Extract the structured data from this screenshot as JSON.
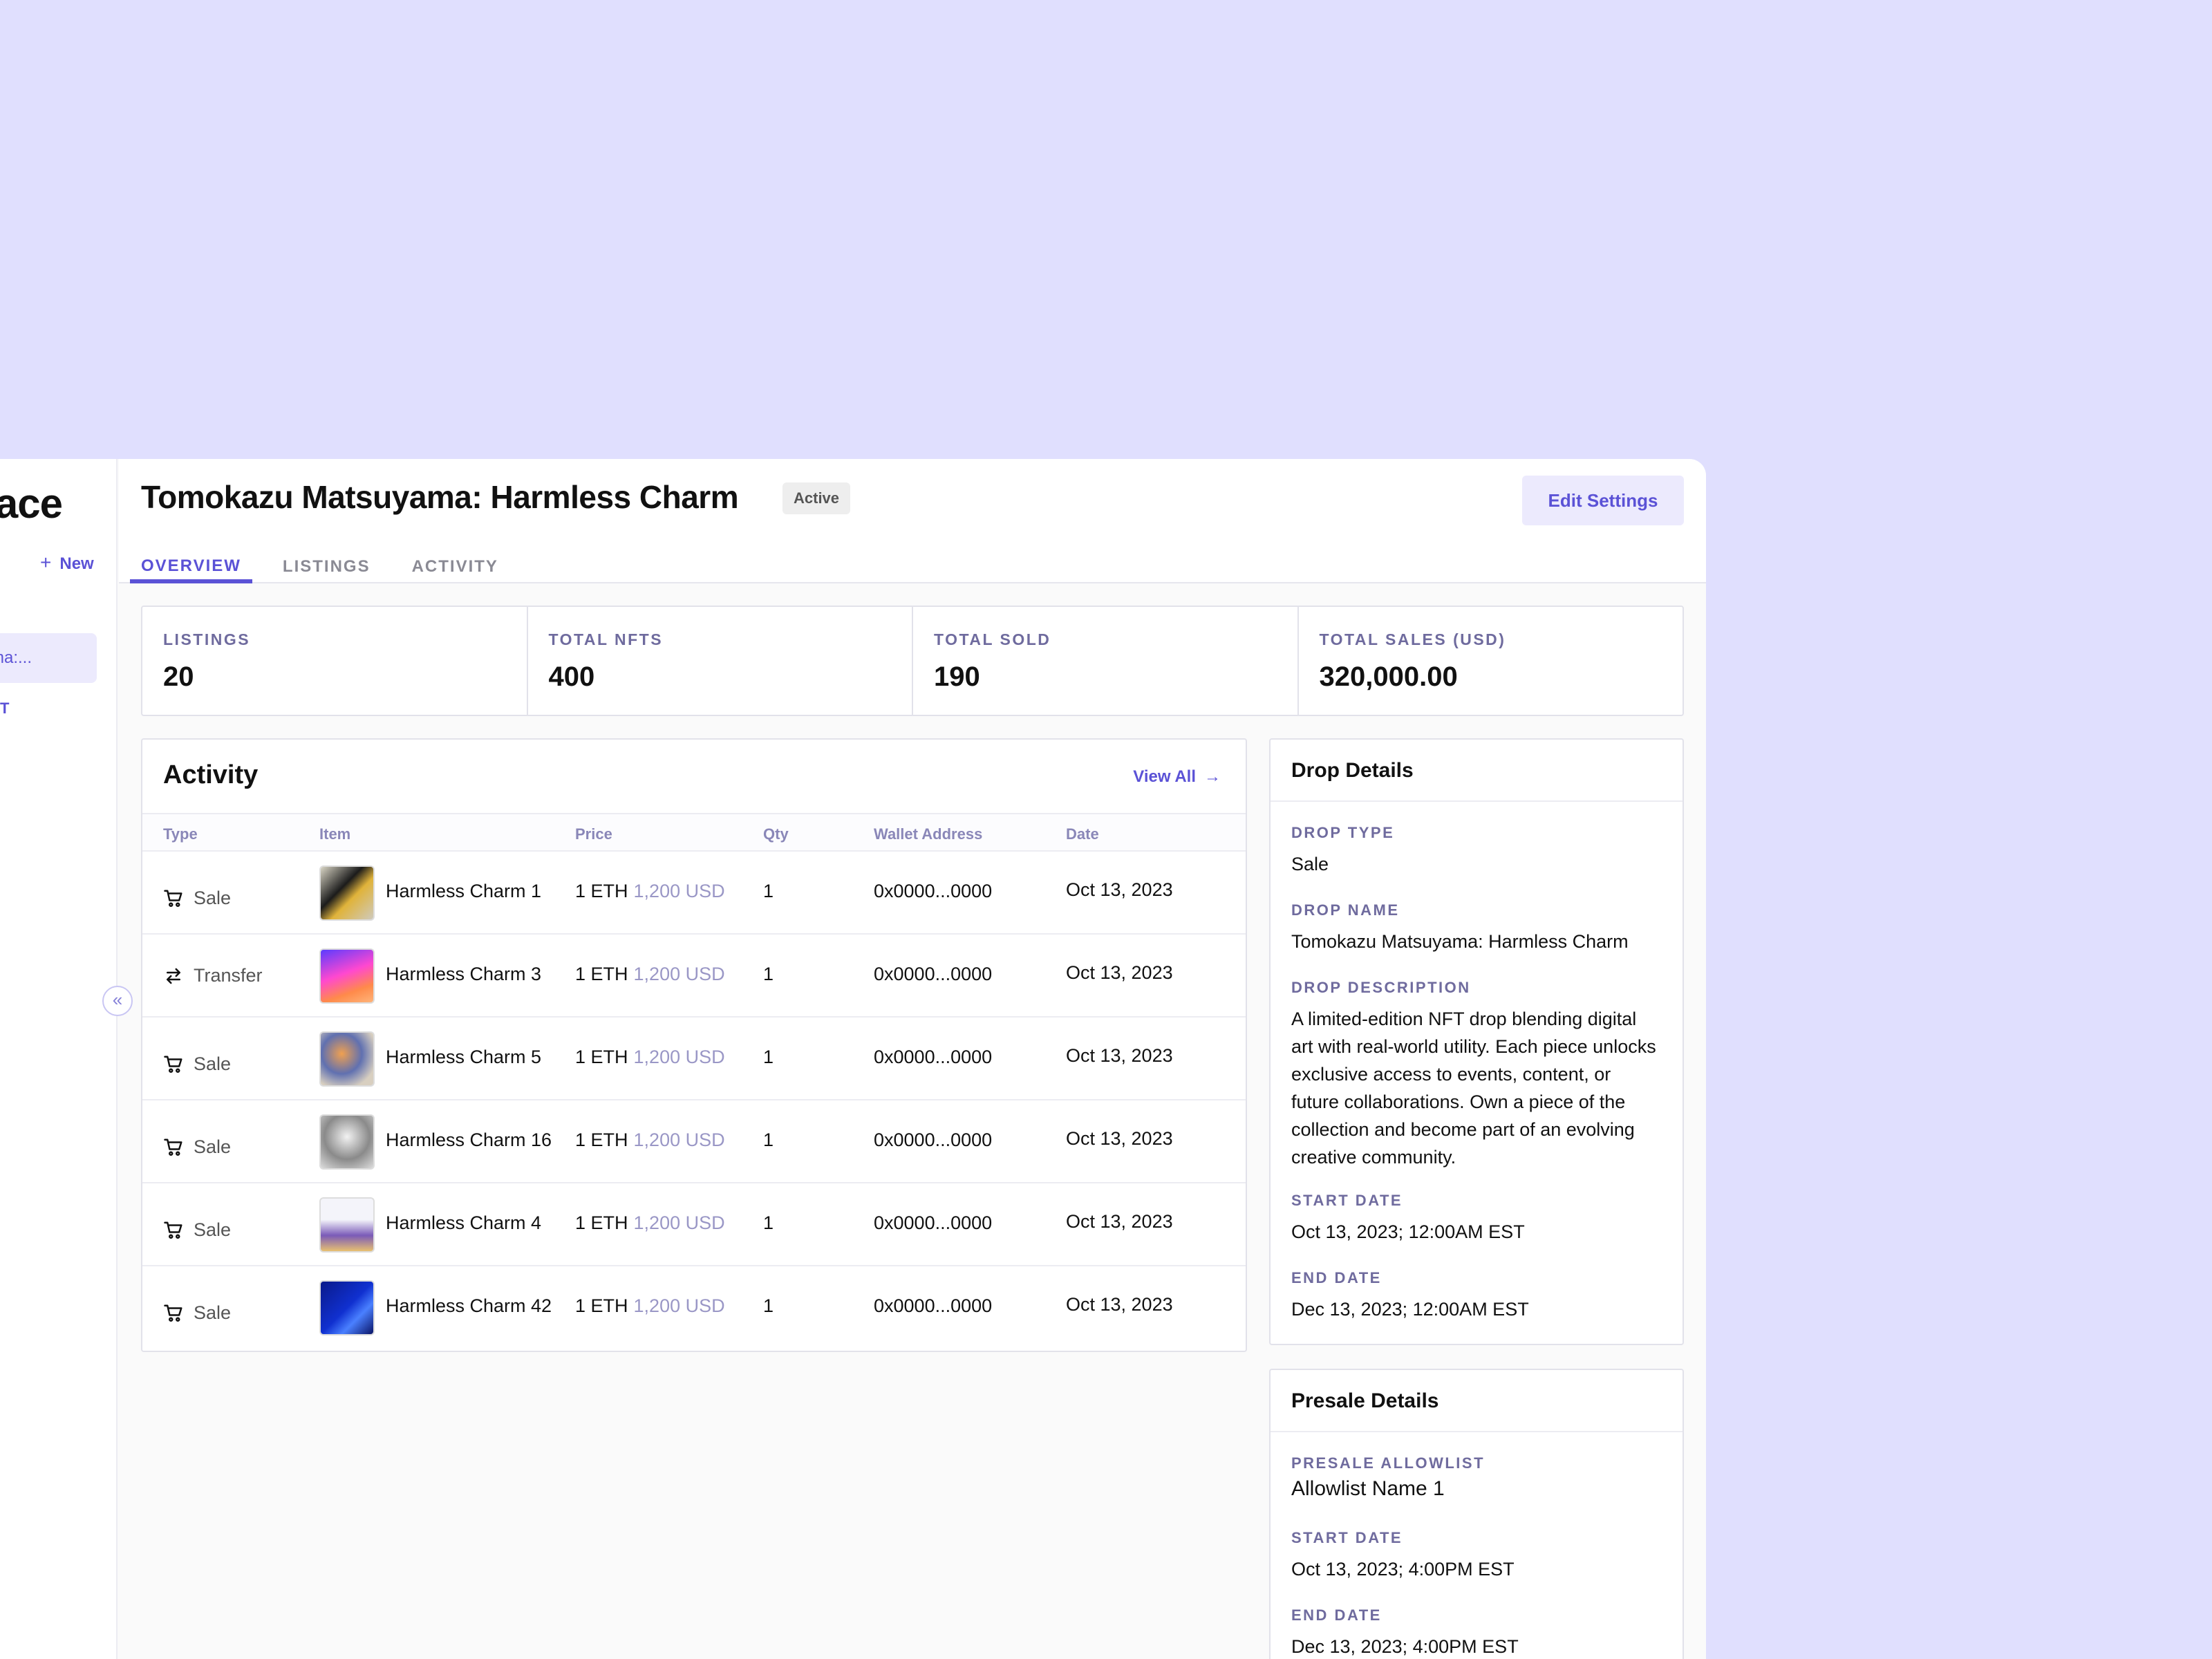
{
  "sidebar": {
    "title_fragment": "ace",
    "new_label": "New",
    "active_item": "ma:...",
    "section_fragment": "T"
  },
  "header": {
    "title": "Tomokazu Matsuyama: Harmless Charm",
    "status": "Active",
    "edit_button": "Edit Settings",
    "tabs": [
      "OVERVIEW",
      "LISTINGS",
      "ACTIVITY"
    ]
  },
  "stats": [
    {
      "label": "LISTINGS",
      "value": "20"
    },
    {
      "label": "TOTAL NFTS",
      "value": "400"
    },
    {
      "label": "TOTAL SOLD",
      "value": "190"
    },
    {
      "label": "TOTAL SALES (USD)",
      "value": "320,000.00"
    }
  ],
  "activity": {
    "title": "Activity",
    "view_all": "View All",
    "columns": [
      "Type",
      "Item",
      "Price",
      "Qty",
      "Wallet Address",
      "Date"
    ],
    "rows": [
      {
        "type": "Sale",
        "item": "Harmless Charm 1",
        "price_eth": "1 ETH",
        "price_usd": "1,200 USD",
        "qty": "1",
        "wallet": "0x0000...0000",
        "date": "Oct 13, 2023"
      },
      {
        "type": "Transfer",
        "item": "Harmless Charm 3",
        "price_eth": "1 ETH",
        "price_usd": "1,200 USD",
        "qty": "1",
        "wallet": "0x0000...0000",
        "date": "Oct 13, 2023"
      },
      {
        "type": "Sale",
        "item": "Harmless Charm 5",
        "price_eth": "1 ETH",
        "price_usd": "1,200 USD",
        "qty": "1",
        "wallet": "0x0000...0000",
        "date": "Oct 13, 2023"
      },
      {
        "type": "Sale",
        "item": "Harmless Charm 16",
        "price_eth": "1 ETH",
        "price_usd": "1,200 USD",
        "qty": "1",
        "wallet": "0x0000...0000",
        "date": "Oct 13, 2023"
      },
      {
        "type": "Sale",
        "item": "Harmless Charm 4",
        "price_eth": "1 ETH",
        "price_usd": "1,200 USD",
        "qty": "1",
        "wallet": "0x0000...0000",
        "date": "Oct 13, 2023"
      },
      {
        "type": "Sale",
        "item": "Harmless Charm 42",
        "price_eth": "1 ETH",
        "price_usd": "1,200 USD",
        "qty": "1",
        "wallet": "0x0000...0000",
        "date": "Oct 13, 2023"
      }
    ]
  },
  "drop_details": {
    "title": "Drop Details",
    "fields": [
      {
        "label": "DROP TYPE",
        "value": "Sale"
      },
      {
        "label": "DROP NAME",
        "value": "Tomokazu Matsuyama: Harmless Charm"
      },
      {
        "label": "DROP DESCRIPTION",
        "value": "A limited-edition NFT drop blending digital art with real-world utility. Each piece unlocks exclusive access to events, content, or future collaborations. Own a piece of the collection and become part of an evolving creative community."
      },
      {
        "label": "START DATE",
        "value": "Oct 13, 2023; 12:00AM EST"
      },
      {
        "label": "END DATE",
        "value": "Dec 13, 2023; 12:00AM EST"
      }
    ]
  },
  "presale_details": {
    "title": "Presale Details",
    "fields": [
      {
        "label": "PRESALE ALLOWLIST",
        "value": "Allowlist Name 1"
      },
      {
        "label": "START DATE",
        "value": "Oct 13, 2023; 4:00PM EST"
      },
      {
        "label": "END DATE",
        "value": "Dec 13, 2023; 4:00PM EST"
      }
    ]
  },
  "colors": {
    "background": "#e0dffe",
    "accent": "#5b52d6",
    "accent_light": "#eceafd",
    "muted_label": "#6f6b9e"
  },
  "icons": {
    "sale": "cart-icon",
    "transfer": "transfer-arrows-icon",
    "collapse": "double-chevron-left-icon",
    "view_all": "arrow-right-icon"
  }
}
